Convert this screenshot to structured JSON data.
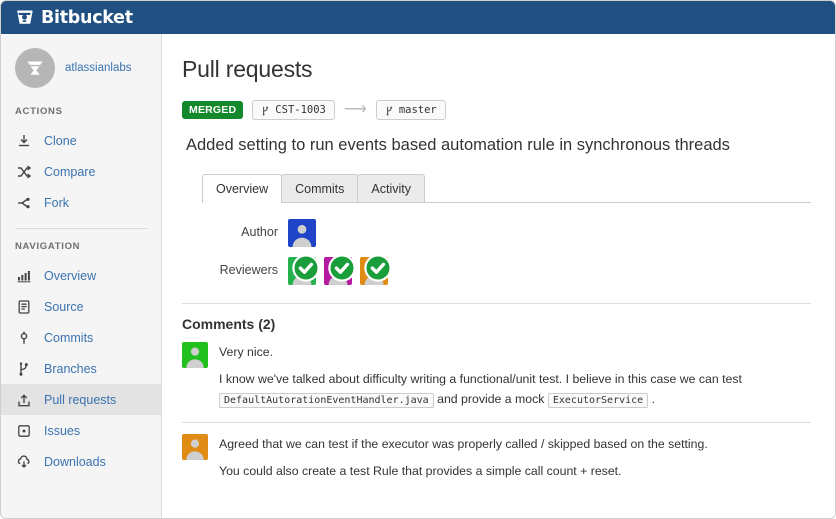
{
  "header": {
    "brand": "Bitbucket",
    "logo_icon": "bitbucket-bucket-icon",
    "bar_color": "#205081"
  },
  "sidebar": {
    "repo": {
      "name": "atlassianlabs",
      "avatar_icon": "atlassian-labs-avatar"
    },
    "sections": [
      {
        "label": "ACTIONS",
        "items": [
          {
            "label": "Clone",
            "icon": "clone-download-icon",
            "active": false
          },
          {
            "label": "Compare",
            "icon": "compare-shuffle-icon",
            "active": false
          },
          {
            "label": "Fork",
            "icon": "fork-icon",
            "active": false
          }
        ]
      },
      {
        "label": "NAVIGATION",
        "items": [
          {
            "label": "Overview",
            "icon": "overview-barchart-icon",
            "active": false
          },
          {
            "label": "Source",
            "icon": "source-file-icon",
            "active": false
          },
          {
            "label": "Commits",
            "icon": "commits-node-icon",
            "active": false
          },
          {
            "label": "Branches",
            "icon": "branches-icon",
            "active": false
          },
          {
            "label": "Pull requests",
            "icon": "pull-request-upload-icon",
            "active": true
          },
          {
            "label": "Issues",
            "icon": "issues-dot-icon",
            "active": false
          },
          {
            "label": "Downloads",
            "icon": "downloads-cloud-icon",
            "active": false
          }
        ]
      }
    ]
  },
  "main": {
    "page_title": "Pull requests",
    "status": {
      "label": "MERGED",
      "color": "#14892c"
    },
    "source_branch": "CST-1003",
    "destination_branch": "master",
    "branch_icon": "branch-icon",
    "arrow_icon": "arrow-right-icon",
    "pr_title": "Added setting to run events based automation rule in synchronous threads",
    "tabs": [
      {
        "label": "Overview",
        "active": true
      },
      {
        "label": "Commits",
        "active": false
      },
      {
        "label": "Activity",
        "active": false
      }
    ],
    "author": {
      "label": "Author",
      "avatars": [
        {
          "color": "#1f44c8",
          "approved": false
        }
      ]
    },
    "reviewers": {
      "label": "Reviewers",
      "avatars": [
        {
          "color": "#22b14c",
          "approved": true
        },
        {
          "color": "#b51ba0",
          "approved": true
        },
        {
          "color": "#e08b14",
          "approved": true
        }
      ]
    },
    "comments": {
      "heading": "Comments (2)",
      "items": [
        {
          "avatar_color": "#22c01f",
          "paragraphs": [
            {
              "parts": [
                {
                  "type": "text",
                  "value": "Very nice."
                }
              ]
            },
            {
              "parts": [
                {
                  "type": "text",
                  "value": "I know we've talked about difficulty writing a functional/unit test. I believe in this case we can test "
                },
                {
                  "type": "code",
                  "value": "DefaultAutorationEventHandler.java"
                },
                {
                  "type": "text",
                  "value": " and provide a mock "
                },
                {
                  "type": "code",
                  "value": "ExecutorService"
                },
                {
                  "type": "text",
                  "value": " ."
                }
              ]
            }
          ]
        },
        {
          "avatar_color": "#e08b14",
          "paragraphs": [
            {
              "parts": [
                {
                  "type": "text",
                  "value": "Agreed that we can test if the executor was properly called / skipped based on the setting."
                }
              ]
            },
            {
              "parts": [
                {
                  "type": "text",
                  "value": "You could also create a test Rule that provides a simple call count + reset."
                }
              ]
            }
          ]
        }
      ]
    }
  }
}
